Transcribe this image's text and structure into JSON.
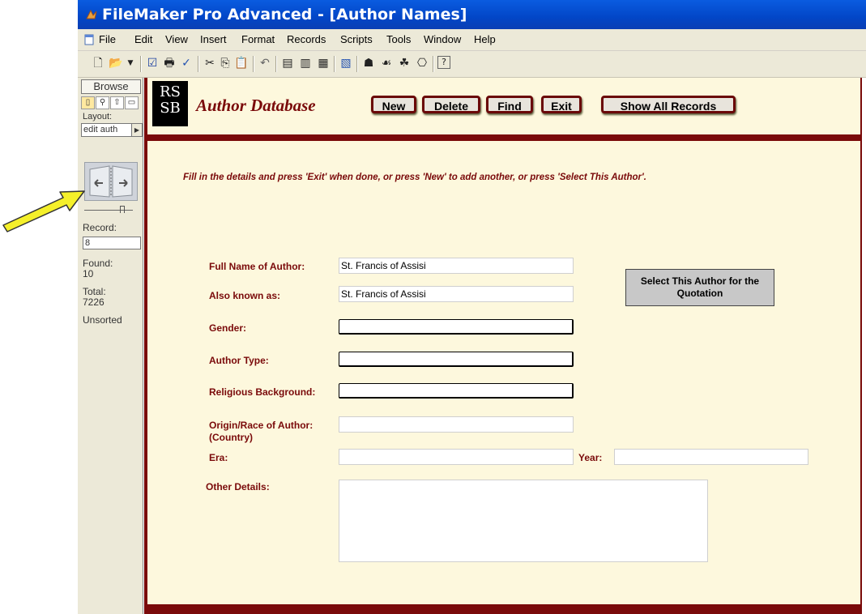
{
  "window": {
    "title": "FileMaker Pro Advanced - [Author Names]"
  },
  "menu": [
    "File",
    "Edit",
    "View",
    "Insert",
    "Format",
    "Records",
    "Scripts",
    "Tools",
    "Window",
    "Help"
  ],
  "status_area": {
    "mode": "Browse",
    "layout_label": "Layout:",
    "layout_value": "edit auth",
    "record_label": "Record:",
    "record_value": "8",
    "found_label": "Found:",
    "found_value": "10",
    "total_label": "Total:",
    "total_value": "7226",
    "sort_state": "Unsorted"
  },
  "header": {
    "logo_line1": "RS",
    "logo_line2": "SB",
    "title": "Author Database",
    "buttons": {
      "new": "New",
      "delete": "Delete",
      "find": "Find",
      "exit": "Exit",
      "show_all": "Show All Records"
    }
  },
  "instructions": "Fill in the details and press 'Exit' when done, or press 'New' to add another, or press 'Select This Author'.",
  "form": {
    "full_name_label": "Full Name of Author:",
    "full_name_value": "St. Francis of Assisi",
    "aka_label": "Also known as:",
    "aka_value": "St. Francis of Assisi",
    "gender_label": "Gender:",
    "gender_value": "",
    "author_type_label": "Author Type:",
    "author_type_value": "",
    "religious_label": "Religious Background:",
    "religious_value": "",
    "origin_label_line1": "Origin/Race of Author:",
    "origin_label_line2": "(Country)",
    "origin_value": "",
    "era_label": "Era:",
    "era_value": "",
    "year_label": "Year:",
    "year_value": "",
    "other_label": "Other Details:",
    "other_value": ""
  },
  "select_author_button": {
    "line1": "Select This Author for the",
    "line2": "Quotation"
  },
  "colors": {
    "maroon": "#7a0a0a",
    "cream": "#fdf8dd",
    "titlebar": "#0246c7",
    "arrow": "#f5f02a"
  }
}
